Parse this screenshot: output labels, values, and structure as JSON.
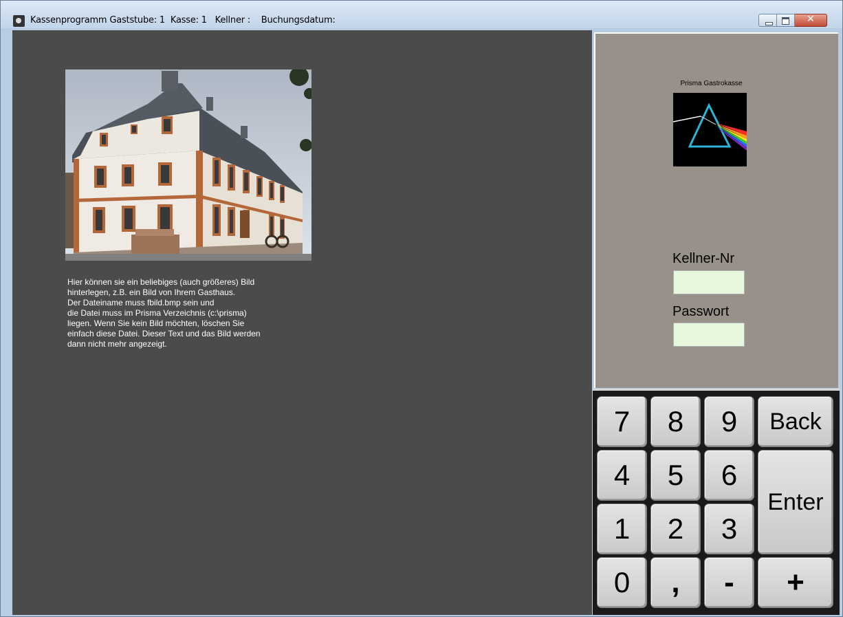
{
  "window": {
    "title": "Kassenprogramm Gaststube: 1  Kasse: 1   Kellner :    Buchungsdatum:",
    "controls": {
      "minimize": "minimize-icon",
      "maximize": "maximize-icon",
      "close": "close-icon"
    }
  },
  "main": {
    "image_alt": "Gasthaus photo",
    "description_lines": [
      "Hier können sie ein beliebiges (auch größeres) Bild",
      "hinterlegen, z.B. ein Bild von Ihrem Gasthaus.",
      "Der Dateiname muss fbild.bmp sein und",
      "die Datei muss im Prisma Verzeichnis (c:\\prisma)",
      "liegen. Wenn Sie kein Bild möchten, löschen Sie",
      "einfach diese Datei. Dieser Text und das Bild werden",
      "dann nicht mehr angezeigt."
    ]
  },
  "login": {
    "brand": "Prisma Gastrokasse",
    "logo_icon": "prism-logo-icon",
    "waiter_label": "Kellner-Nr",
    "waiter_value": "",
    "password_label": "Passwort",
    "password_value": ""
  },
  "keypad": {
    "keys": {
      "k7": "7",
      "k8": "8",
      "k9": "9",
      "back": "Back",
      "k4": "4",
      "k5": "5",
      "k6": "6",
      "enter": "Enter",
      "k1": "1",
      "k2": "2",
      "k3": "3",
      "k0": "0",
      "comma": ",",
      "minus": "-",
      "plus": "+"
    }
  },
  "colors": {
    "main_bg": "#4b4b4b",
    "login_bg": "#989189",
    "field_bg": "#e6f7de",
    "key_bg": "#d6d6d6"
  }
}
